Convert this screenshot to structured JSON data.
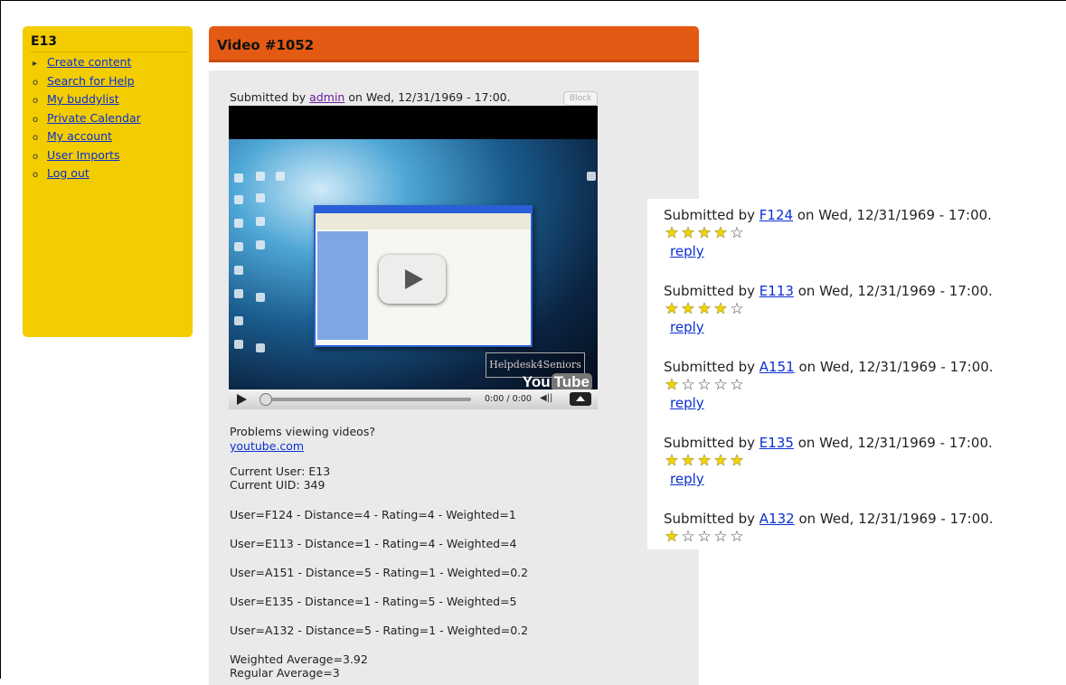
{
  "sidebar": {
    "title": "E13",
    "items": [
      {
        "label": "Create content",
        "bullet": "▸"
      },
      {
        "label": "Search for Help",
        "bullet": "o"
      },
      {
        "label": "My buddylist",
        "bullet": "o"
      },
      {
        "label": "Private Calendar",
        "bullet": "o"
      },
      {
        "label": "My account",
        "bullet": "o"
      },
      {
        "label": "User Imports",
        "bullet": "o"
      },
      {
        "label": "Log out",
        "bullet": "o"
      }
    ]
  },
  "header": {
    "title": "Video #1052"
  },
  "node": {
    "submitted_prefix": "Submitted by",
    "author": "admin",
    "submitted_suffix": "on Wed, 12/31/1969 - 17:00.",
    "block_label": "Block"
  },
  "player": {
    "time": "0:00 / 0:00",
    "watermark": "Helpdesk4Seniors",
    "logo_you": "You",
    "logo_tube": "Tube"
  },
  "info": {
    "problems": "Problems viewing videos?",
    "youtube_link": "youtube.com",
    "current_user": "Current User: E13",
    "current_uid": "Current UID: 349",
    "ratings": [
      "User=F124 - Distance=4 - Rating=4 - Weighted=1",
      "User=E113 - Distance=1 - Rating=4 - Weighted=4",
      "User=A151 - Distance=5 - Rating=1 - Weighted=0.2",
      "User=E135 - Distance=1 - Rating=5 - Weighted=5",
      "User=A132 - Distance=5 - Rating=1 - Weighted=0.2"
    ],
    "weighted_average": "Weighted Average=3.92",
    "regular_average": "Regular Average=3"
  },
  "comments": {
    "prefix": "Submitted by",
    "suffix": "on Wed, 12/31/1969 - 17:00.",
    "reply_label": "reply",
    "items": [
      {
        "user": "F124",
        "rating": 4,
        "max": 5,
        "has_reply": true
      },
      {
        "user": "E113",
        "rating": 4,
        "max": 5,
        "has_reply": true
      },
      {
        "user": "A151",
        "rating": 1,
        "max": 5,
        "has_reply": true
      },
      {
        "user": "E135",
        "rating": 5,
        "max": 5,
        "has_reply": true
      },
      {
        "user": "A132",
        "rating": 1,
        "max": 5,
        "has_reply": false
      }
    ]
  }
}
